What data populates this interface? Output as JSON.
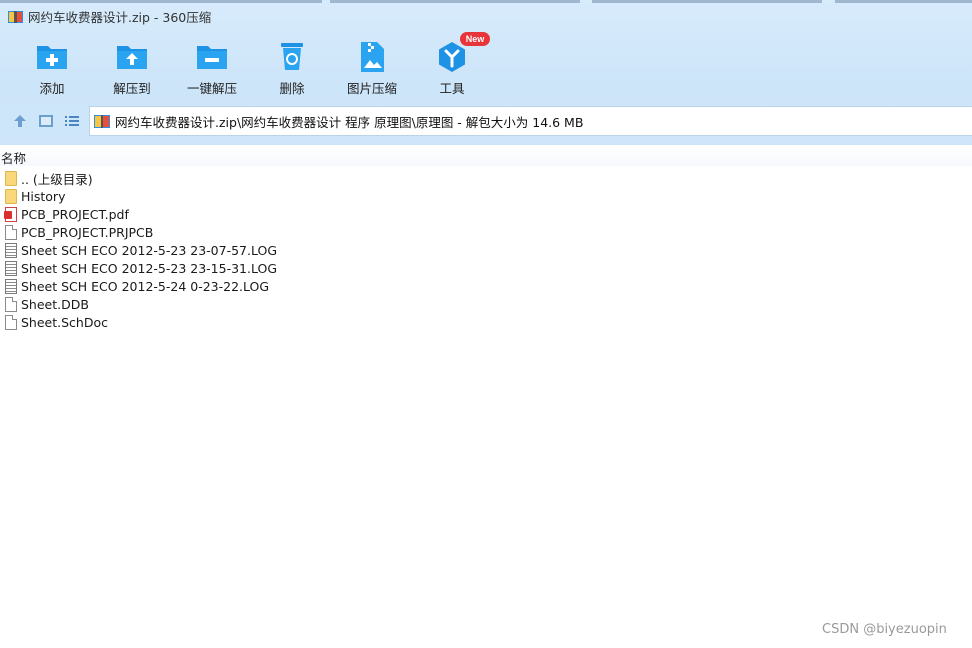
{
  "window": {
    "title": "网约车收费器设计.zip - 360压缩"
  },
  "toolbar": {
    "items": [
      {
        "label": "添加",
        "icon": "add-icon"
      },
      {
        "label": "解压到",
        "icon": "extract-to-icon"
      },
      {
        "label": "一键解压",
        "icon": "one-click-extract-icon"
      },
      {
        "label": "删除",
        "icon": "delete-icon"
      },
      {
        "label": "图片压缩",
        "icon": "image-compress-icon"
      },
      {
        "label": "工具",
        "icon": "tools-icon",
        "badge": "New"
      }
    ]
  },
  "address": {
    "path": "网约车收费器设计.zip\\网约车收费器设计 程序 原理图\\原理图 - 解包大小为 14.6 MB"
  },
  "list": {
    "column_name": "名称",
    "files": [
      {
        "name": ".. (上级目录)",
        "type": "folder"
      },
      {
        "name": "History",
        "type": "folder"
      },
      {
        "name": "PCB_PROJECT.pdf",
        "type": "pdf"
      },
      {
        "name": "PCB_PROJECT.PRJPCB",
        "type": "doc"
      },
      {
        "name": "Sheet SCH ECO 2012-5-23 23-07-57.LOG",
        "type": "log"
      },
      {
        "name": "Sheet SCH ECO 2012-5-23 23-15-31.LOG",
        "type": "log"
      },
      {
        "name": "Sheet SCH ECO 2012-5-24 0-23-22.LOG",
        "type": "log"
      },
      {
        "name": "Sheet.DDB",
        "type": "doc"
      },
      {
        "name": "Sheet.SchDoc",
        "type": "doc"
      }
    ]
  },
  "watermark": "CSDN @biyezuopin",
  "colors": {
    "chrome_bg": "#d2e8fa",
    "icon_blue": "#1e93e6",
    "badge_red": "#e8353a",
    "folder_yellow": "#f9d77b"
  }
}
